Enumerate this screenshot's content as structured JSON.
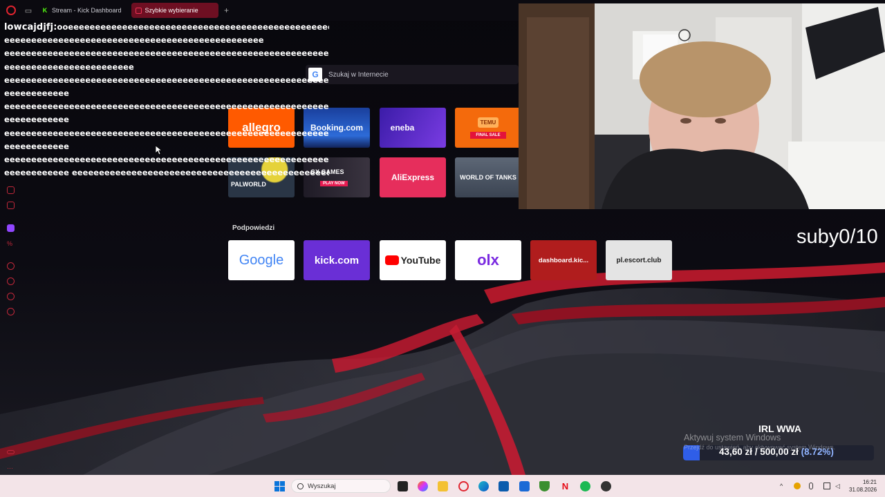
{
  "tabs": [
    {
      "label": "Stream - Kick Dashboard",
      "favicon": "K"
    },
    {
      "label": "Szybkie wybieranie",
      "active": true
    }
  ],
  "chat": {
    "username": "lowcajdjfj:",
    "lines": [
      "ooeeeeeeeeeeeeeeeeeeeeeeeeeeeeeeeeeeeeeeeeeeeeeeeeeeeeeeeeeeeeee",
      "eeeeeeeeeeeeeeeeeeeeeeeeeeeeeeeeeeeeeeeeeeeeeeee",
      "eeeeeeeeeeeeeeeeeeeeeeeeeeeeeeeeeeeeeeeeeeeeeeeeeeeeeeeeeeeeeeeeeeeeeeeeeeee",
      "eeeeeeeeeeeeeeeeeeeeeeee",
      "eeeeeeeeeeeeeeeeeeeeeeeeeeeeeeeeeeeeeeeeeeeeeeeeeeeeeeeeeeeeeeeeeeeeeeeeeeee",
      "eeeeeeeeeeee",
      "eeeeeeeeeeeeeeeeeeeeeeeeeeeeeeeeeeeeeeeeeeeeeeeeeeeeeeeeeeeeeeeeeeeeeeeeeeee",
      "eeeeeeeeeeee",
      "eeeeeeeeeeeeeeeeeeeeeeeeeeeeeeeeeeeeeeeeeeeeeeeeeeeeeeeeeeeeeeeeeeeeeeeeeeee",
      "eeeeeeeeeeee",
      "eeeeeeeeeeeeeeeeeeeeeeeeeeeeeeeeeeeeeeeeeeeeeeeeeeeeeeeeeeeeeeeeeeeeeeeeeeee",
      "eeeeeeeeeeee eeeeeeeeeeeeeeeeeeeeeeeeeeeeeeeeeeeeeeeeeeeeeeeeeeeeeeeeeeeeeee"
    ]
  },
  "search": {
    "placeholder": "Szukaj w Internecie"
  },
  "speed_dials": [
    {
      "label": "allegro",
      "color": "#ff5a00"
    },
    {
      "label": "Booking.com",
      "color": "#1a3f9c"
    },
    {
      "label": "eneba",
      "color": "#5b2bd1"
    },
    {
      "label": "TEMU",
      "sub": "FINAL SALE",
      "color": "#f46a0c"
    },
    {
      "label": "PALWORLD",
      "color": "#2a3646"
    },
    {
      "label": "GX GAMES",
      "sub": "PLAY NOW",
      "color": "#2b2533"
    },
    {
      "label": "AliExpress",
      "color": "#e62e5c"
    },
    {
      "label": "WORLD OF TANKS",
      "color": "#4b5564"
    }
  ],
  "hints_label": "Podpowiedzi",
  "hints": [
    {
      "label": "Google",
      "color": "#ffffff"
    },
    {
      "label": "kick.com",
      "color": "#6a2fd6"
    },
    {
      "label": "YouTube",
      "color": "#ffffff"
    },
    {
      "label": "olx",
      "color": "#ffffff"
    },
    {
      "label": "dashboard.kic...",
      "color": "#b01d1d"
    },
    {
      "label": "pl.escort.club",
      "color": "#e4e4e4"
    }
  ],
  "overlay": {
    "subs": "suby0/10",
    "goal_title": "IRL WWA",
    "goal_amount": "43,60 zł / 500,00 zł",
    "goal_percent": "(8.72%)",
    "goal_fraction": 0.0872,
    "activate_title": "Aktywuj system Windows",
    "activate_sub": "Przejdź do ustawień, aby aktywować system Windows."
  },
  "taskbar": {
    "search_placeholder": "Wyszukaj",
    "time": "16:21",
    "date": "31.08.2026"
  },
  "colors": {
    "accent": "#d01f33",
    "kick_green": "#53fc18"
  }
}
